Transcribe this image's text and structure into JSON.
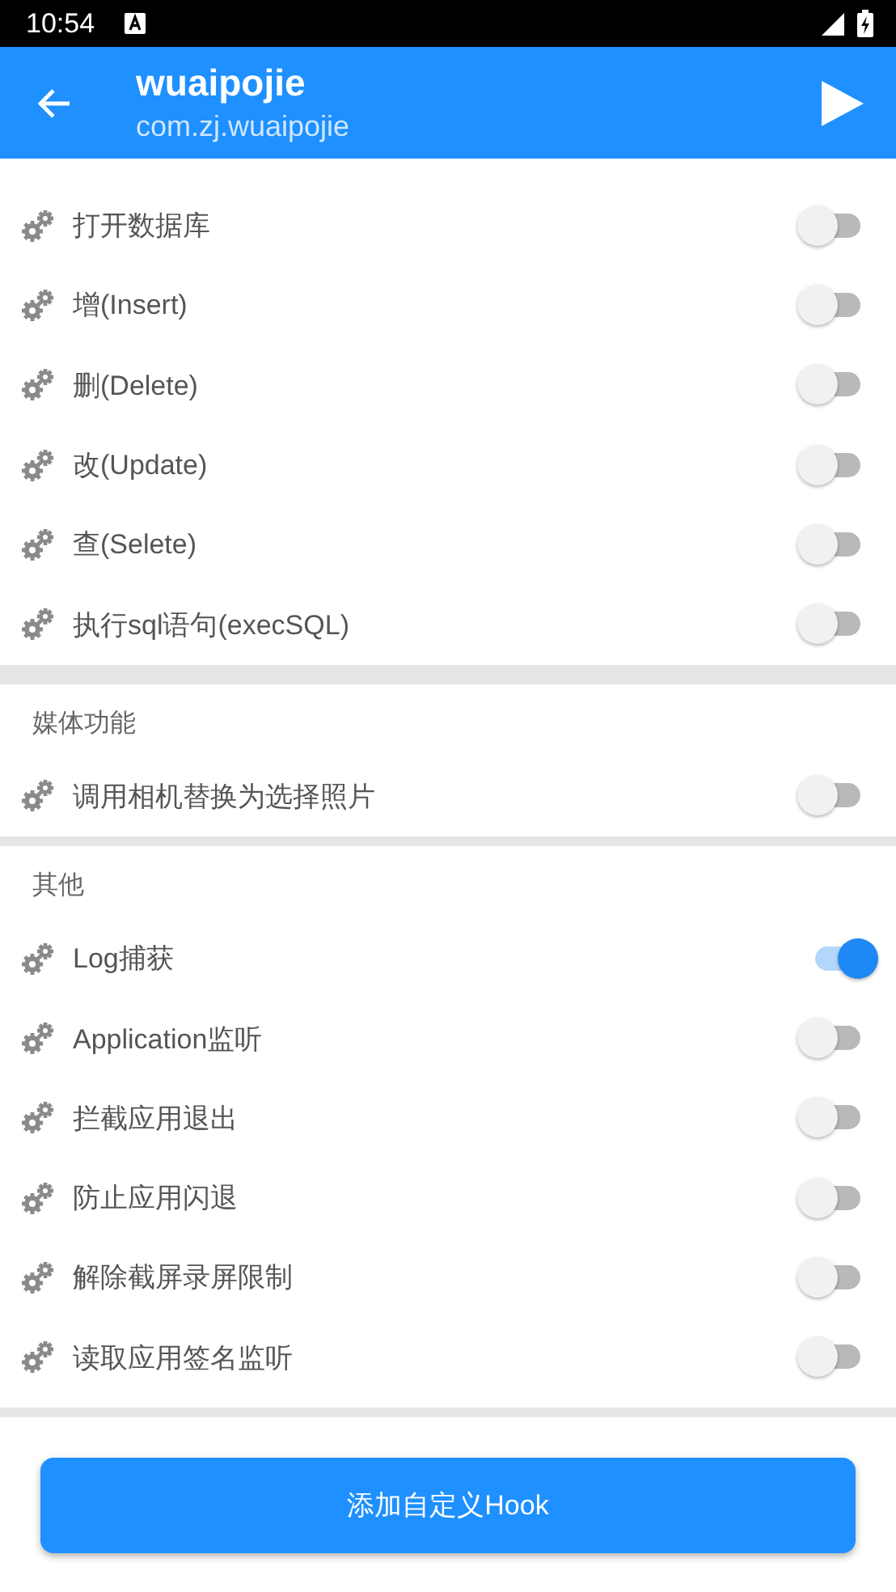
{
  "status_bar": {
    "time": "10:54"
  },
  "app_bar": {
    "title": "wuaipojie",
    "subtitle": "com.zj.wuaipojie"
  },
  "sections": [
    {
      "items": [
        {
          "label": "打开数据库",
          "on": false
        },
        {
          "label": "增(Insert)",
          "on": false
        },
        {
          "label": "删(Delete)",
          "on": false
        },
        {
          "label": "改(Update)",
          "on": false
        },
        {
          "label": "查(Selete)",
          "on": false
        },
        {
          "label": "执行sql语句(execSQL)",
          "on": false
        }
      ]
    },
    {
      "header": "媒体功能",
      "items": [
        {
          "label": "调用相机替换为选择照片",
          "on": false
        }
      ]
    },
    {
      "header": "其他",
      "items": [
        {
          "label": "Log捕获",
          "on": true
        },
        {
          "label": "Application监听",
          "on": false
        },
        {
          "label": "拦截应用退出",
          "on": false
        },
        {
          "label": "防止应用闪退",
          "on": false
        },
        {
          "label": "解除截屏录屏限制",
          "on": false
        },
        {
          "label": "读取应用签名监听",
          "on": false
        }
      ]
    }
  ],
  "button": "添加自定义Hook"
}
